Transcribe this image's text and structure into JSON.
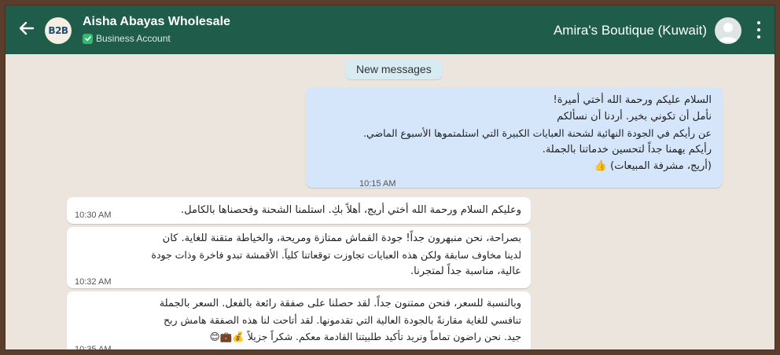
{
  "header": {
    "logo_text": "B2B",
    "title": "Aisha Abayas Wholesale",
    "account_type": "Business Account",
    "contact": "Amira's Boutique (Kuwait)"
  },
  "banner": {
    "new_messages": "New messages"
  },
  "messages": [
    {
      "lines": [
        "السلام عليكم ورحمة الله أختي أميرة!",
        "نأمل أن تكوني بخير. أردنا أن نسألكم",
        "عن رأيكم في الجودة النهائية لشحنة العبايات الكبيرة التي استلمتموها الأسبوع الماضي.",
        "رأيكم يهمنا جداً لتحسين خدماتنا بالجملة.",
        "(أريج، مشرفة المبيعات) 👍"
      ],
      "time": "10:15 AM"
    },
    {
      "lines": [
        "وعليكم السلام ورحمة الله أختي أريج، أهلاً بكِ. استلمنا الشحنة وفحصناها بالكامل."
      ],
      "time": "10:30 AM"
    },
    {
      "lines": [
        "بصراحة، نحن منبهرون جداً! جودة القماش ممتازة ومريحة، والخياطة متقنة للغاية. كان",
        "لدينا مخاوف سابقة ولكن هذه العبايات تجاوزت توقعاتنا كلياً. الأقمشة تبدو فاخرة وذات جودة",
        "عالية، مناسبة جداً لمتجرنا."
      ],
      "time": "10:32 AM"
    },
    {
      "lines": [
        "وبالنسبة للسعر، فنحن ممتنون جداً. لقد حصلنا على صفقة رائعة بالفعل. السعر بالجملة",
        "تنافسي للغاية مقارنةً بالجودة العالية التي تقدمونها. لقد أتاحت لنا هذه الصفقة هامش ربح",
        "جيد. نحن راضون تماماً ونريد تأكيد طلبيتنا القادمة معكم. شكراً جزيلاً 💰💼😊"
      ],
      "time": "10:35 AM"
    }
  ],
  "colors": {
    "header": "#1f5c4a",
    "chat_bg": "#ece5dd",
    "outgoing_bubble": "#d5e6fa",
    "incoming_bubble": "#ffffff",
    "verified": "#2fbf6c"
  }
}
